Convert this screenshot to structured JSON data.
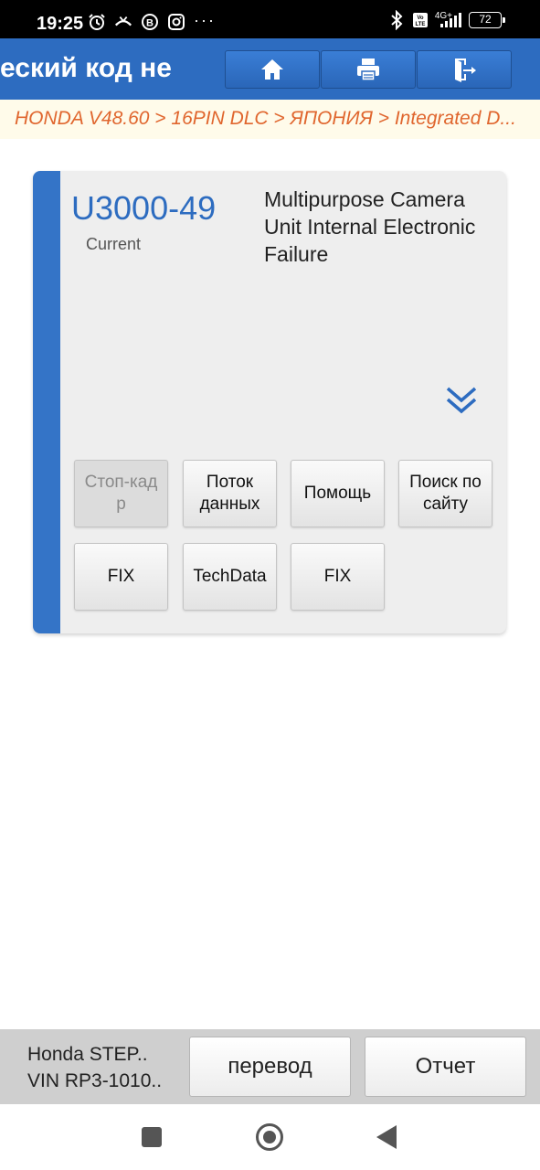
{
  "status_bar": {
    "time": "19:25",
    "dots": "···",
    "network": "4G+",
    "volte": "Vo LTE",
    "battery": "72"
  },
  "header": {
    "title": "Диагностический код не",
    "visible_title": "еский код не",
    "buttons": [
      "home-icon",
      "print-icon",
      "exit-icon"
    ]
  },
  "breadcrumb": "HONDA V48.60 > 16PIN DLC > ЯПОНИЯ > Integrated D...",
  "dtc": {
    "code": "U3000-49",
    "status": "Current",
    "description": "Multipurpose Camera Unit Internal Electronic Failure"
  },
  "actions": {
    "freeze_frame": "Стоп-кад р",
    "data_stream": "Поток данных",
    "help": "Помощь",
    "site_search": "Поиск по сайту",
    "fix_1": "FIX",
    "techdata": "TechData",
    "fix_2": "FIX"
  },
  "bottom": {
    "vehicle_line1": "Honda STEP..",
    "vehicle_line2": "VIN RP3-1010..",
    "translate": "перевод",
    "report": "Отчет"
  },
  "colors": {
    "header_blue": "#2d6cc0",
    "breadcrumb_text": "#e0662e",
    "dtc_code": "#2d6cc0"
  }
}
